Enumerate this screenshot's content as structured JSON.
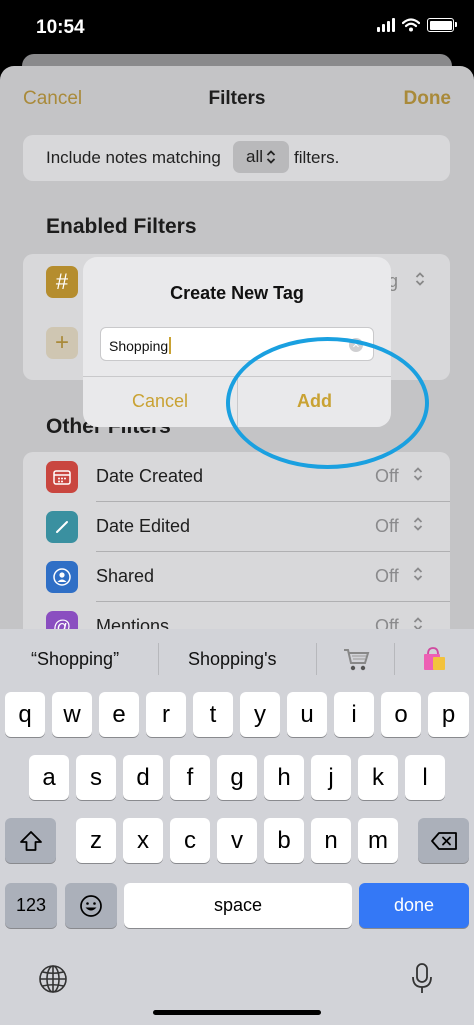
{
  "status": {
    "time": "10:54"
  },
  "nav": {
    "cancel": "Cancel",
    "title": "Filters",
    "done": "Done"
  },
  "include": {
    "prefix": "Include notes matching",
    "value": "all",
    "suffix": "filters."
  },
  "enabled": {
    "title": "Enabled Filters",
    "partial_value": "g"
  },
  "other": {
    "title": "Other Filters",
    "rows": [
      {
        "label": "Date Created",
        "value": "Off",
        "icon": "calendar-icon",
        "color": "#c9463f"
      },
      {
        "label": "Date Edited",
        "value": "Off",
        "icon": "pencil-icon",
        "color": "#3a90a0"
      },
      {
        "label": "Shared",
        "value": "Off",
        "icon": "shared-person-icon",
        "color": "#2f6fc6"
      },
      {
        "label": "Mentions",
        "value": "Off",
        "icon": "at-icon",
        "color": "#8a4ec0"
      }
    ]
  },
  "dialog": {
    "title": "Create New Tag",
    "input_value": "Shopping",
    "cancel": "Cancel",
    "add": "Add"
  },
  "keyboard": {
    "suggestions": [
      "“Shopping”",
      "Shopping's"
    ],
    "row1": [
      "q",
      "w",
      "e",
      "r",
      "t",
      "y",
      "u",
      "i",
      "o",
      "p"
    ],
    "row2": [
      "a",
      "s",
      "d",
      "f",
      "g",
      "h",
      "j",
      "k",
      "l"
    ],
    "row3": [
      "z",
      "x",
      "c",
      "v",
      "b",
      "n",
      "m"
    ],
    "numbers": "123",
    "space": "space",
    "done": "done"
  },
  "colors": {
    "accent": "#c9a233",
    "done_key": "#3478f6",
    "annotation": "#1aa0e0"
  }
}
